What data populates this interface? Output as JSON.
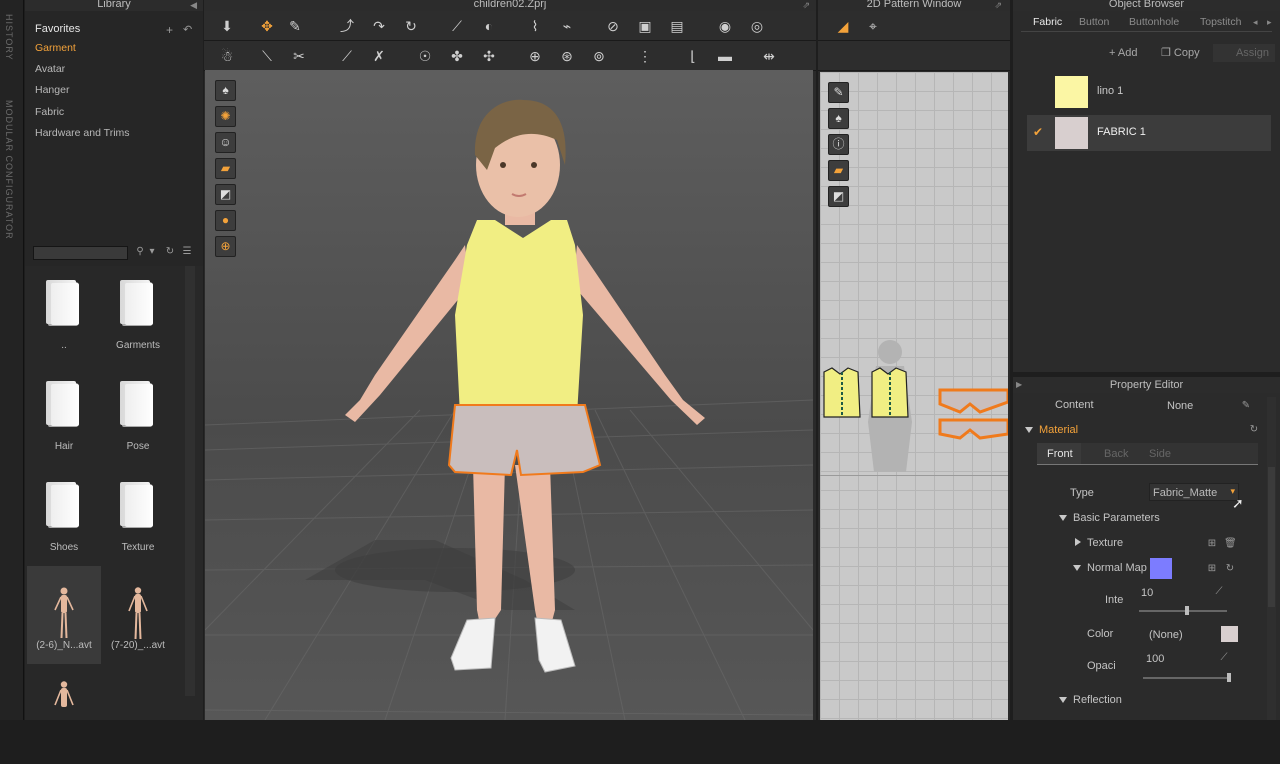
{
  "side_strip": {
    "history": "HISTORY",
    "modular": "MODULAR CONFIGURATOR"
  },
  "library": {
    "title": "Library",
    "favorites_heading": "Favorites",
    "favorites": [
      "Garment",
      "Avatar",
      "Hanger",
      "Fabric",
      "Hardware and Trims"
    ],
    "active_favorite": "Garment",
    "tiles": [
      {
        "label": "..",
        "kind": "folder"
      },
      {
        "label": "Garments",
        "kind": "folder"
      },
      {
        "label": "Hair",
        "kind": "folder"
      },
      {
        "label": "Pose",
        "kind": "folder"
      },
      {
        "label": "Shoes",
        "kind": "folder"
      },
      {
        "label": "Texture",
        "kind": "folder"
      },
      {
        "label": "(2-6)_N...avt",
        "kind": "avatar"
      },
      {
        "label": "(7-20)_...avt",
        "kind": "avatar"
      },
      {
        "label": "",
        "kind": "avatar"
      }
    ]
  },
  "viewport": {
    "title": "children02.Zprj"
  },
  "pattern_window": {
    "title": "2D Pattern Window"
  },
  "object_browser": {
    "title": "Object Browser",
    "tabs": [
      "Fabric",
      "Button",
      "Buttonhole",
      "Topstitch"
    ],
    "active_tab": "Fabric",
    "add_label": "Add",
    "copy_label": "Copy",
    "assign_label": "Assign",
    "fabrics": [
      {
        "name": "lino 1",
        "color": "#fbf6a4",
        "selected": false
      },
      {
        "name": "FABRIC 1",
        "color": "#d8cfcf",
        "selected": true
      }
    ]
  },
  "property_editor": {
    "title": "Property Editor",
    "content_label": "Content",
    "content_value": "None",
    "material_label": "Material",
    "tabs": [
      "Front",
      "Back",
      "Side"
    ],
    "active_tab": "Front",
    "type_label": "Type",
    "type_value": "Fabric_Matte",
    "basic_params_label": "Basic Parameters",
    "texture_label": "Texture",
    "normal_map_label": "Normal Map",
    "normal_map_color": "#7c7cff",
    "intensity_label": "Inte",
    "intensity_value": "10",
    "intensity_level": 0.55,
    "color_label": "Color",
    "color_value": "(None)",
    "color_swatch": "#d8cfcf",
    "opacity_label": "Opaci",
    "opacity_value": "100",
    "opacity_level": 1.0,
    "reflection_label": "Reflection"
  },
  "colors": {
    "accent": "#f3a23a",
    "shirt": "#f1ee83",
    "shorts": "#c9bebd",
    "piping": "#f07a1c"
  }
}
